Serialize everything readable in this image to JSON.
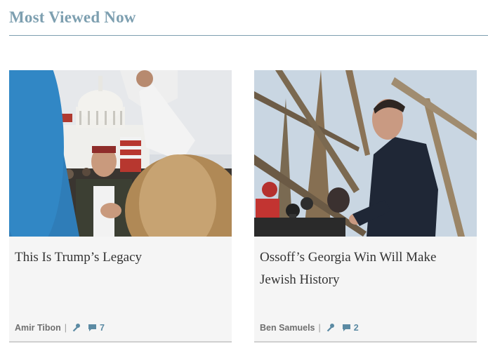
{
  "section": {
    "title": "Most Viewed Now"
  },
  "colors": {
    "accent": "#7d9fb0",
    "icon": "#5b8aa3"
  },
  "cards": [
    {
      "headline": "This Is Trump’s Legacy",
      "author": "Amir Tibon",
      "comments": "7",
      "icons": [
        "key-icon",
        "comment-icon"
      ]
    },
    {
      "headline": "Ossoff’s Georgia Win Will Make Jewish History",
      "author": "Ben Samuels",
      "comments": "2",
      "icons": [
        "key-icon",
        "comment-icon"
      ]
    }
  ]
}
